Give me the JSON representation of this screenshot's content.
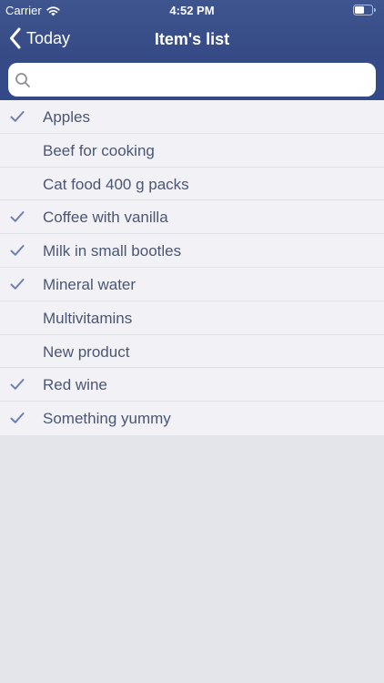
{
  "status_bar": {
    "carrier": "Carrier",
    "time": "4:52 PM"
  },
  "nav": {
    "back_label": "Today",
    "title": "Item's list"
  },
  "search": {
    "placeholder": "",
    "value": ""
  },
  "items": [
    {
      "label": "Apples",
      "checked": true
    },
    {
      "label": "Beef for cooking",
      "checked": false
    },
    {
      "label": "Cat food 400 g packs",
      "checked": false
    },
    {
      "label": "Coffee with vanilla",
      "checked": true
    },
    {
      "label": "Milk in small bootles",
      "checked": true
    },
    {
      "label": "Mineral water",
      "checked": true
    },
    {
      "label": "Multivitamins",
      "checked": false
    },
    {
      "label": "New product",
      "checked": false
    },
    {
      "label": "Red wine",
      "checked": true
    },
    {
      "label": "Something yummy",
      "checked": true
    }
  ],
  "colors": {
    "header": "#3a4f8b",
    "checkmark": "#6e80b3",
    "row_text": "#4a5673",
    "list_background": "#f2f2f6",
    "empty_background": "#e4e5ea"
  },
  "icons": {
    "wifi": "wifi-icon",
    "battery": "battery-icon",
    "back": "back-chevron-icon",
    "search": "search-icon",
    "check": "check-icon"
  }
}
